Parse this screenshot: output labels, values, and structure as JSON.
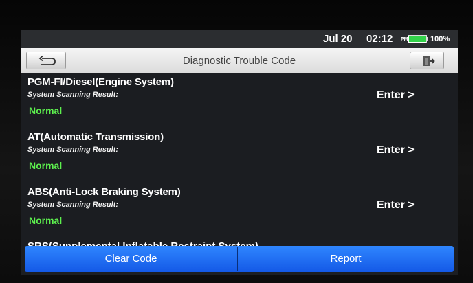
{
  "status_bar": {
    "date": "Jul 20",
    "time": "02:12",
    "ampm": "PM",
    "battery": "100%",
    "battery_level": 1.0
  },
  "header": {
    "title": "Diagnostic Trouble Code",
    "back_icon": "back-arrow-icon",
    "exit_icon": "exit-door-icon"
  },
  "systems": [
    {
      "name": "PGM-FI/Diesel(Engine System)",
      "label": "System Scanning Result:",
      "status": "Normal",
      "action": "Enter >"
    },
    {
      "name": "AT(Automatic Transmission)",
      "label": "System Scanning Result:",
      "status": "Normal",
      "action": "Enter >"
    },
    {
      "name": "ABS(Anti-Lock Braking System)",
      "label": "System Scanning Result:",
      "status": "Normal",
      "action": "Enter >"
    },
    {
      "name": "SRS(Supplemental Inflatable Restraint System)"
    }
  ],
  "footer": {
    "clear_label": "Clear Code",
    "report_label": "Report"
  },
  "colors": {
    "status_normal": "#5df04e",
    "button_blue": "#1f6ff5",
    "title_bar": "#e6e6e6"
  }
}
